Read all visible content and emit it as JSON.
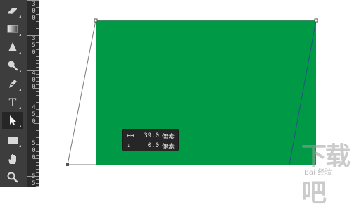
{
  "toolbar": {
    "tools": [
      {
        "icon": "eraser-icon"
      },
      {
        "icon": "gradient-icon"
      },
      {
        "icon": "sharpen-icon"
      },
      {
        "icon": "dodge-icon"
      },
      {
        "icon": "pen-icon"
      },
      {
        "icon": "type-icon",
        "glyph": "T"
      },
      {
        "icon": "direct-selection-icon",
        "active": true
      },
      {
        "icon": "rectangle-icon"
      },
      {
        "icon": "hand-icon"
      },
      {
        "icon": "zoom-icon"
      }
    ]
  },
  "ruler": {
    "labels": [
      "3 0 0",
      "3 5 0",
      "4 0 0",
      "4 5 0",
      "5 0 0",
      "5 5"
    ]
  },
  "tooltip": {
    "dx_icon": "↤→",
    "dx_value": "39.0",
    "dx_unit": "像素",
    "dy_icon": "⇣",
    "dy_value": "0.0",
    "dy_unit": "像素"
  },
  "watermark": {
    "big": "下载吧",
    "small": "Bai 经验"
  },
  "colors": {
    "shape_fill": "#009946",
    "toolbar_bg": "#3d3d3d",
    "ruler_bg": "#2b2b2b",
    "tooltip_bg": "#262626"
  }
}
